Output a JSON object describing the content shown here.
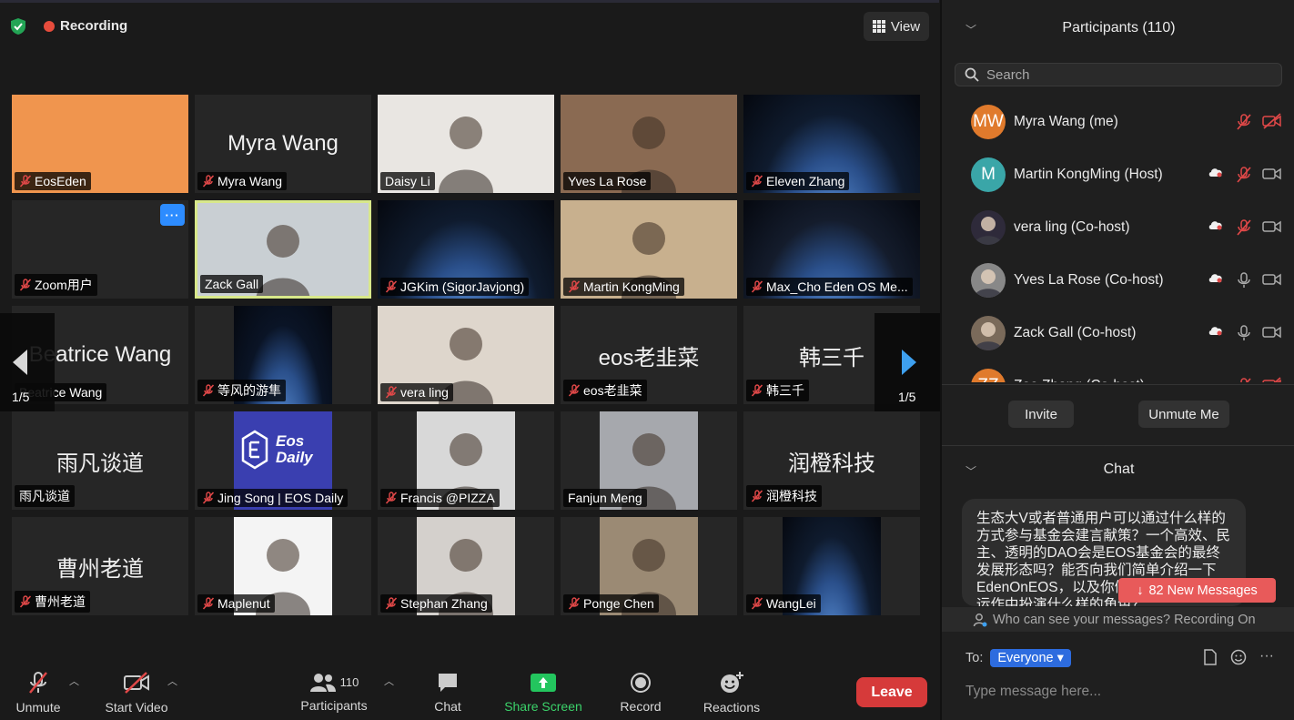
{
  "header": {
    "recording_label": "Recording",
    "view_label": "View"
  },
  "gallery": {
    "page_indicator": "1/5",
    "tiles": [
      {
        "name": "EosEden",
        "big": "",
        "muted": true,
        "kind": "color",
        "color": "#f0954e"
      },
      {
        "name": "Myra Wang",
        "big": "Myra Wang",
        "muted": true,
        "kind": "text"
      },
      {
        "name": "Daisy Li",
        "big": "",
        "muted": false,
        "kind": "photo",
        "color": "#e9e6e2"
      },
      {
        "name": "Yves La Rose",
        "big": "",
        "muted": false,
        "kind": "photo",
        "color": "#8a6a52"
      },
      {
        "name": "Eleven Zhang",
        "big": "",
        "muted": true,
        "kind": "earth",
        "color": "#0f1b2e"
      },
      {
        "name": "Zoom用户",
        "big": "",
        "muted": true,
        "kind": "blank"
      },
      {
        "name": "Zack Gall",
        "big": "",
        "muted": false,
        "kind": "photo",
        "color": "#c9cfd3"
      },
      {
        "name": "JGKim (SigorJavjong)",
        "big": "",
        "muted": true,
        "kind": "earth",
        "color": "#0f1b2e"
      },
      {
        "name": "Martin KongMing",
        "big": "",
        "muted": true,
        "kind": "photo",
        "color": "#c8b08e"
      },
      {
        "name": "Max_Cho Eden OS Me...",
        "big": "",
        "muted": true,
        "kind": "earth",
        "color": "#141c2c"
      },
      {
        "name": "Beatrice Wang",
        "big": "Beatrice Wang",
        "muted": false,
        "kind": "text"
      },
      {
        "name": "等风的游隼",
        "big": "",
        "muted": true,
        "kind": "earth",
        "color": "#0a1426"
      },
      {
        "name": "vera ling",
        "big": "",
        "muted": true,
        "kind": "photo",
        "color": "#ded6cc"
      },
      {
        "name": "eos老韭菜",
        "big": "eos老韭菜",
        "muted": true,
        "kind": "text"
      },
      {
        "name": "韩三千",
        "big": "韩三千",
        "muted": true,
        "kind": "text"
      },
      {
        "name": "雨凡谈道",
        "big": "雨凡谈道",
        "muted": false,
        "kind": "text"
      },
      {
        "name": "Jing Song | EOS Daily",
        "big": "",
        "muted": true,
        "kind": "logo",
        "color": "#3a3fb0"
      },
      {
        "name": "Francis @PIZZA",
        "big": "",
        "muted": true,
        "kind": "photo",
        "color": "#d8d8d8"
      },
      {
        "name": "Fanjun Meng",
        "big": "",
        "muted": false,
        "kind": "photo",
        "color": "#a6a8ad"
      },
      {
        "name": "润橙科技",
        "big": "润橙科技",
        "muted": true,
        "kind": "text"
      },
      {
        "name": "曹州老道",
        "big": "曹州老道",
        "muted": true,
        "kind": "text"
      },
      {
        "name": "Maplenut",
        "big": "",
        "muted": true,
        "kind": "photo",
        "color": "#f4f4f4"
      },
      {
        "name": "Stephan Zhang",
        "big": "",
        "muted": true,
        "kind": "photo",
        "color": "#d4d0cc"
      },
      {
        "name": "Ponge Chen",
        "big": "",
        "muted": true,
        "kind": "photo",
        "color": "#9b8a74"
      },
      {
        "name": "WangLei",
        "big": "",
        "muted": true,
        "kind": "earth",
        "color": "#0f1b2e"
      }
    ],
    "logo_text_1": "Eos",
    "logo_text_2": "Daily"
  },
  "toolbar": {
    "unmute_label": "Unmute",
    "start_video_label": "Start Video",
    "participants_label": "Participants",
    "participants_count": "110",
    "chat_label": "Chat",
    "share_screen_label": "Share Screen",
    "record_label": "Record",
    "reactions_label": "Reactions",
    "leave_label": "Leave"
  },
  "participants_panel": {
    "title": "Participants (110)",
    "search_placeholder": "Search",
    "list": [
      {
        "name": "Myra Wang (me)",
        "initials": "MW",
        "avatar_color": "#e07a2c",
        "cloud": false,
        "mic": "muted",
        "cam": "off"
      },
      {
        "name": "Martin KongMing (Host)",
        "initials": "M",
        "avatar_color": "#3aa6a8",
        "cloud": true,
        "mic": "muted",
        "cam": "on"
      },
      {
        "name": "vera ling (Co-host)",
        "initials": "",
        "avatar_color": "#2e2a3a",
        "cloud": true,
        "mic": "muted",
        "cam": "on"
      },
      {
        "name": "Yves La Rose (Co-host)",
        "initials": "",
        "avatar_color": "#888",
        "cloud": true,
        "mic": "on",
        "cam": "on"
      },
      {
        "name": "Zack Gall (Co-host)",
        "initials": "",
        "avatar_color": "#7a6a5a",
        "cloud": true,
        "mic": "on",
        "cam": "on"
      },
      {
        "name": "Zoe Zhang (Co-host)",
        "initials": "ZZ",
        "avatar_color": "#e07a2c",
        "cloud": false,
        "mic": "muted",
        "cam": "off"
      }
    ],
    "invite_label": "Invite",
    "unmute_me_label": "Unmute Me"
  },
  "chat_panel": {
    "title": "Chat",
    "message": "生态大V或者普通用户可以通过什么样的方式参与基金会建言献策？一个高效、民主、透明的DAO会是EOS基金会的最终发展形态吗？能否向我们简单介绍一下EdenOnEOS，以及你们在EOS基金会的运作中扮演什么样的角色？",
    "new_messages_label": "82 New Messages",
    "visibility_notice": "Who can see your messages? Recording On",
    "to_label": "To:",
    "recipient": "Everyone",
    "input_placeholder": "Type message here..."
  }
}
